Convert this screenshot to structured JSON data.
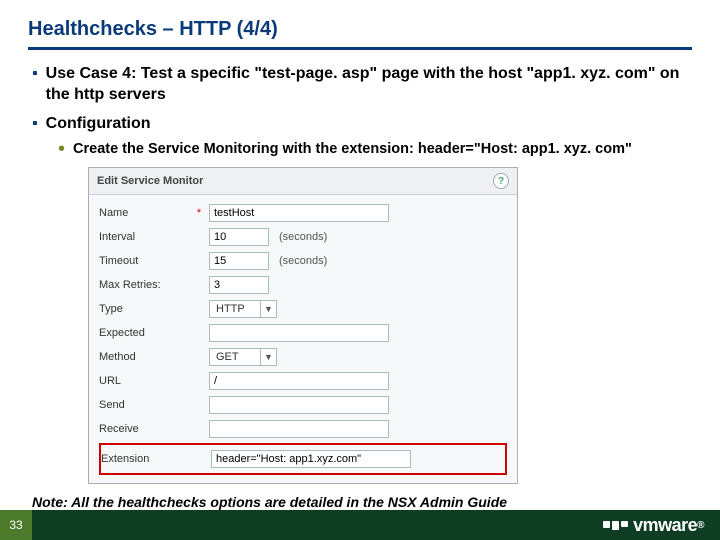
{
  "title": "Healthchecks – HTTP (4/4)",
  "bullets": {
    "use_case": "Use Case 4: Test a specific \"test-page. asp\" page with the host \"app1. xyz. com\" on the http servers",
    "configuration": "Configuration",
    "config_sub": "Create the Service Monitoring with the extension: header=\"Host: app1. xyz. com\""
  },
  "panel": {
    "title": "Edit Service Monitor",
    "help": "?",
    "labels": {
      "name": "Name",
      "interval": "Interval",
      "timeout": "Timeout",
      "maxretries": "Max Retries:",
      "type": "Type",
      "expected": "Expected",
      "method": "Method",
      "url": "URL",
      "send": "Send",
      "receive": "Receive",
      "extension": "Extension"
    },
    "required_mark": "*",
    "values": {
      "name": "testHost",
      "interval": "10",
      "timeout": "15",
      "maxretries": "3",
      "type": "HTTP",
      "expected": "",
      "method": "GET",
      "url": "/",
      "send": "",
      "receive": "",
      "extension": "header=\"Host: app1.xyz.com\""
    },
    "units": "(seconds)",
    "chevron": "▼"
  },
  "note": "Note: All the healthchecks options are detailed in the NSX Admin Guide",
  "footer": {
    "page": "33",
    "brand": "vmware"
  }
}
